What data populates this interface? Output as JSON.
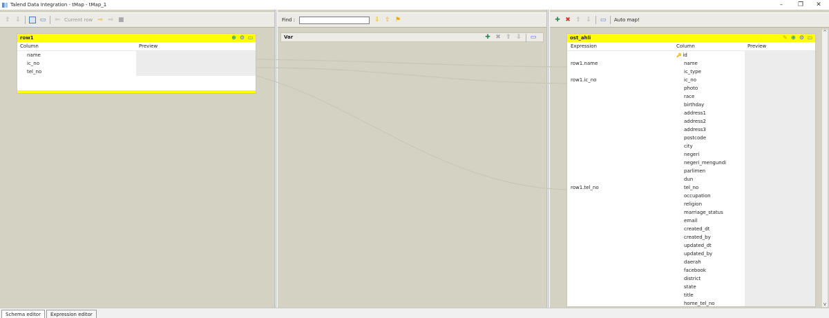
{
  "window": {
    "title": "Talend Data Integration - tMap - tMap_1",
    "minimize": "–",
    "restore": "❐",
    "close": "✕"
  },
  "left_toolbar": {
    "current_row_label": "Current row"
  },
  "center_toolbar": {
    "find_label": "Find :",
    "find_value": ""
  },
  "right_toolbar": {
    "auto_map_label": "Auto map!"
  },
  "input_table": {
    "name": "row1",
    "col_header": "Column",
    "preview_header": "Preview",
    "rows": [
      "name",
      "ic_no",
      "tel_no"
    ]
  },
  "var_table": {
    "name": "Var"
  },
  "output_table": {
    "name": "ost_ahli",
    "expr_header": "Expression",
    "col_header": "Column",
    "preview_header": "Preview",
    "rows": [
      {
        "expr": "",
        "col": "id",
        "key": true
      },
      {
        "expr": "row1.name",
        "col": "name"
      },
      {
        "expr": "",
        "col": "ic_type"
      },
      {
        "expr": "row1.ic_no",
        "col": "ic_no"
      },
      {
        "expr": "",
        "col": "photo"
      },
      {
        "expr": "",
        "col": "race"
      },
      {
        "expr": "",
        "col": "birthday"
      },
      {
        "expr": "",
        "col": "address1"
      },
      {
        "expr": "",
        "col": "address2"
      },
      {
        "expr": "",
        "col": "address3"
      },
      {
        "expr": "",
        "col": "postcode"
      },
      {
        "expr": "",
        "col": "city"
      },
      {
        "expr": "",
        "col": "negeri"
      },
      {
        "expr": "",
        "col": "negeri_mengundi"
      },
      {
        "expr": "",
        "col": "parlimen"
      },
      {
        "expr": "",
        "col": "dun"
      },
      {
        "expr": "row1.tel_no",
        "col": "tel_no"
      },
      {
        "expr": "",
        "col": "occupation"
      },
      {
        "expr": "",
        "col": "religion"
      },
      {
        "expr": "",
        "col": "marriage_status"
      },
      {
        "expr": "",
        "col": "email"
      },
      {
        "expr": "",
        "col": "created_dt"
      },
      {
        "expr": "",
        "col": "created_by"
      },
      {
        "expr": "",
        "col": "updated_dt"
      },
      {
        "expr": "",
        "col": "updated_by"
      },
      {
        "expr": "",
        "col": "daerah"
      },
      {
        "expr": "",
        "col": "facebook"
      },
      {
        "expr": "",
        "col": "district"
      },
      {
        "expr": "",
        "col": "state"
      },
      {
        "expr": "",
        "col": "title"
      },
      {
        "expr": "",
        "col": "home_tel_no"
      }
    ]
  },
  "bottom_tabs": [
    "Schema editor",
    "Expression editor"
  ],
  "colors": {
    "table_header": "#ffff00",
    "pane_bg": "#d4d3c3",
    "link_line": "#c8c6b8"
  }
}
